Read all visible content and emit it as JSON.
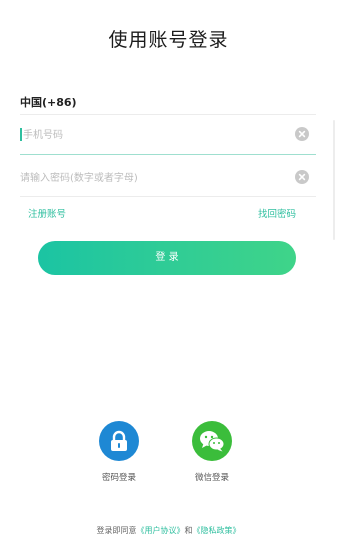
{
  "title": "使用账号登录",
  "country_code": "中国(+86)",
  "phone": {
    "value": "",
    "placeholder": "手机号码",
    "clear_icon": "clear-icon"
  },
  "password": {
    "value": "",
    "placeholder": "请输入密码(数字或者字母)",
    "clear_icon": "clear-icon"
  },
  "links": {
    "register": "注册账号",
    "forgot": "找回密码"
  },
  "login_button": "登 录",
  "alt_login": [
    {
      "label": "密码登录",
      "icon": "lock-icon",
      "color": "#1e88d4"
    },
    {
      "label": "微信登录",
      "icon": "wechat-icon",
      "color": "#3bbd3b"
    }
  ],
  "agreement": {
    "prefix": "登录即同意",
    "user_agreement": "《用户协议》",
    "and": "和",
    "privacy_policy": "《隐私政策》"
  },
  "colors": {
    "accent": "#2fbf9f",
    "button_gradient_start": "#1bc4a3",
    "button_gradient_end": "#3fd489",
    "clear_icon": "#c9c9c9",
    "text_primary": "#1c1c1c",
    "placeholder": "#bcbcbc"
  }
}
